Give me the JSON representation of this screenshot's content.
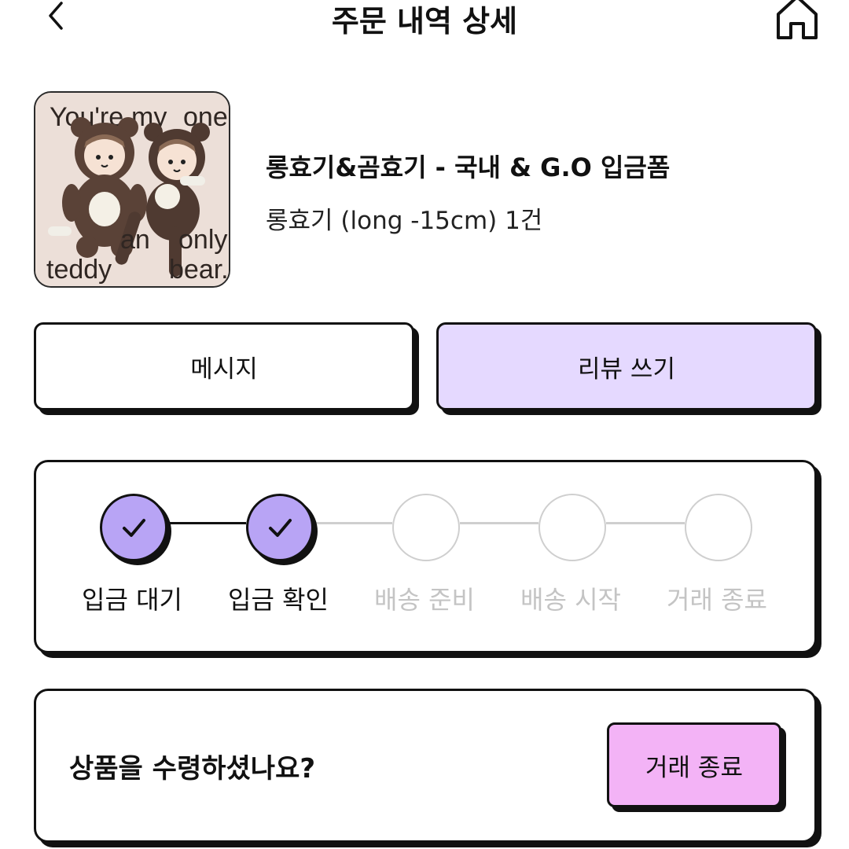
{
  "header": {
    "title": "주문 내역 상세",
    "back_icon": "chevron-left-icon",
    "home_icon": "home-icon"
  },
  "product": {
    "image_text": {
      "line1_a": "You're",
      "line1_b": "my",
      "line1_c": "one",
      "line2_a": "an",
      "line2_b": "only",
      "line3_a": "teddy",
      "line3_b": "bear."
    },
    "title": "롱효기&곰효기 - 국내 & G.O 입금폼",
    "option": "롱효기 (long -15cm) 1건"
  },
  "actions": {
    "message_label": "메시지",
    "review_label": "리뷰 쓰기"
  },
  "progress": {
    "steps": [
      {
        "label": "입금 대기",
        "done": true
      },
      {
        "label": "입금 확인",
        "done": true
      },
      {
        "label": "배송 준비",
        "done": false
      },
      {
        "label": "배송 시작",
        "done": false
      },
      {
        "label": "거래 종료",
        "done": false
      }
    ]
  },
  "receipt": {
    "question": "상품을 수령하셨나요?",
    "finish_label": "거래 종료"
  },
  "colors": {
    "review_bg": "#e5d9ff",
    "step_done": "#b8a4f5",
    "finish_bg": "#f3b3f6",
    "todo_gray": "#c4c4c4"
  }
}
